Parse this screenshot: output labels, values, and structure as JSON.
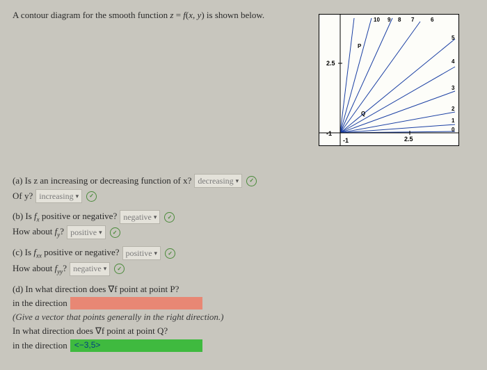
{
  "prompt": "A contour diagram for the smooth function z = f(x, y) is shown below.",
  "chart_data": {
    "type": "contour",
    "axes": {
      "x_marks": [
        "-1",
        "2.5"
      ],
      "y_marks": [
        "-1",
        "2.5"
      ]
    },
    "contour_values": [
      "0",
      "1",
      "2",
      "3",
      "4",
      "5",
      "6",
      "7",
      "8",
      "9",
      "10"
    ],
    "points_marked": [
      "P",
      "Q"
    ],
    "description": "Radial contour lines fanning outward from lower-left region; levels increase clockwise from upper-left (10) to lower-right (0)."
  },
  "parts": {
    "a": {
      "q1": "(a) Is z an increasing or decreasing function of x?",
      "a1": "decreasing",
      "q2": "Of y?",
      "a2": "increasing"
    },
    "b": {
      "q1_pre": "(b) Is ",
      "q1_sym": "f",
      "q1_sub": "x",
      "q1_post": " positive or negative?",
      "a1": "negative",
      "q2_pre": "How about ",
      "q2_sym": "f",
      "q2_sub": "y",
      "q2_post": "?",
      "a2": "positive"
    },
    "c": {
      "q1_pre": "(c) Is ",
      "q1_sym": "f",
      "q1_sub": "xx",
      "q1_post": " positive or negative?",
      "a1": "positive",
      "q2_pre": "How about ",
      "q2_sym": "f",
      "q2_sub": "yy",
      "q2_post": "?",
      "a2": "negative"
    },
    "d": {
      "q1": "(d) In what direction does ∇f point at point P?",
      "lead": "in the direction",
      "note": "(Give a vector that points generally in the right direction.)",
      "q2": "In what direction does ∇f point at point Q?",
      "lead2": "in the direction",
      "ans2": "<−3,5>"
    }
  }
}
